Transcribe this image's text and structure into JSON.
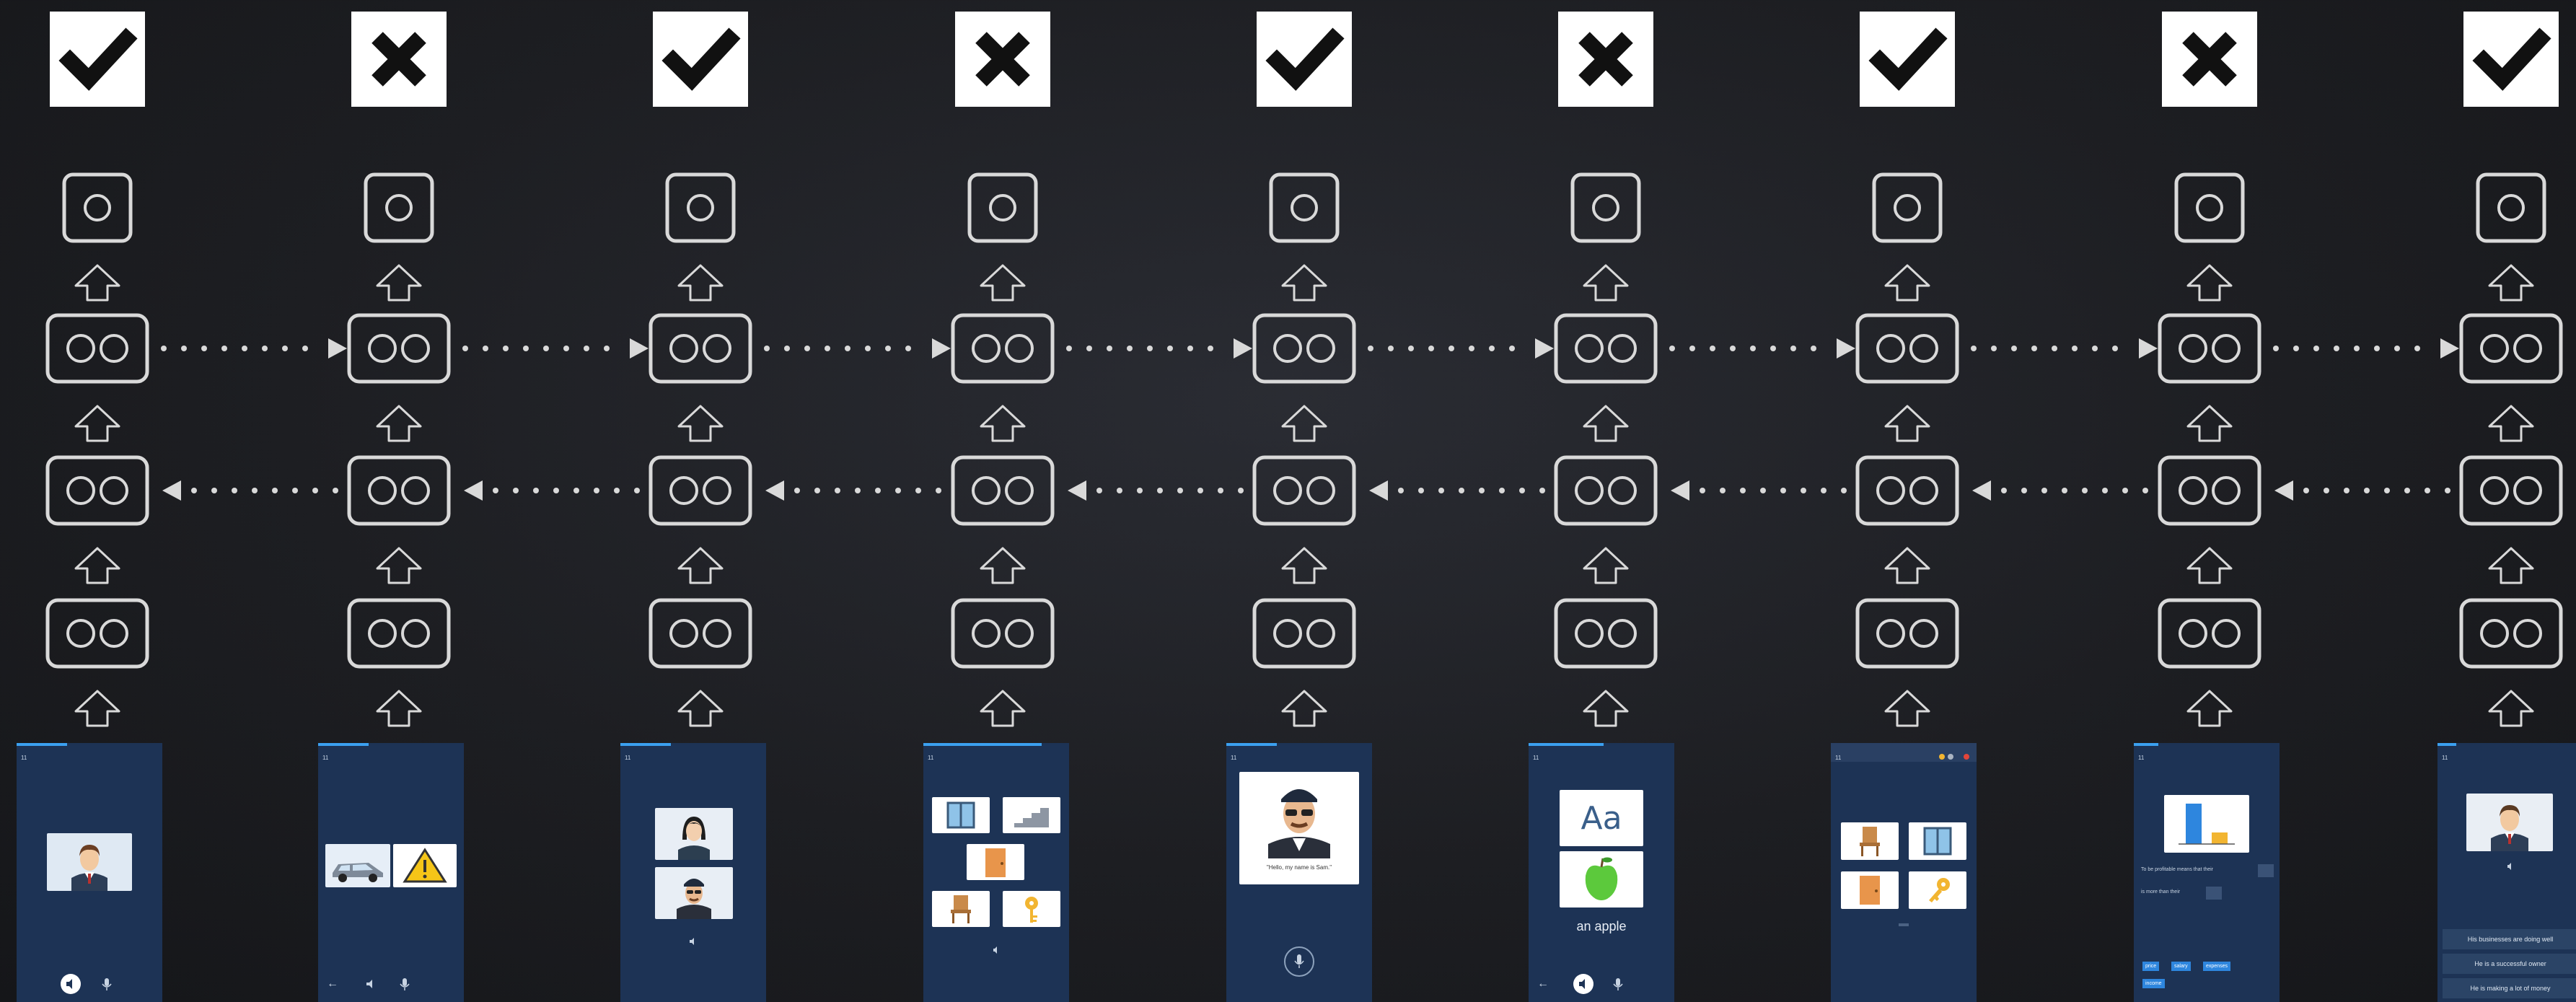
{
  "columns": [
    {
      "result": "correct"
    },
    {
      "result": "incorrect"
    },
    {
      "result": "correct"
    },
    {
      "result": "incorrect"
    },
    {
      "result": "correct"
    },
    {
      "result": "incorrect"
    },
    {
      "result": "correct"
    },
    {
      "result": "incorrect"
    },
    {
      "result": "correct"
    }
  ],
  "icons": {
    "correct": "checkmark-icon",
    "incorrect": "x-mark-icon",
    "up": "up-arrow-icon",
    "output": "output-unit-icon",
    "hidden": "hidden-unit-icon"
  },
  "colors": {
    "background": "#1d1e22",
    "line": "#d9d9d9",
    "phone": "#1d3355",
    "accent": "#3ba0f0"
  },
  "screens": {
    "time": "11",
    "s5_quote": "\"Hello, my name is Sam.\"",
    "s6_glyph": "Aa",
    "s6_caption": "an apple",
    "s8_sentence1": "To be profitable means that their",
    "s8_sentence2": "is more than their",
    "s8_options": [
      "price",
      "salary",
      "expenses",
      "income"
    ],
    "s9_choices": [
      "His businesses are doing well",
      "He is a successful owner",
      "He is making a lot of money"
    ]
  }
}
